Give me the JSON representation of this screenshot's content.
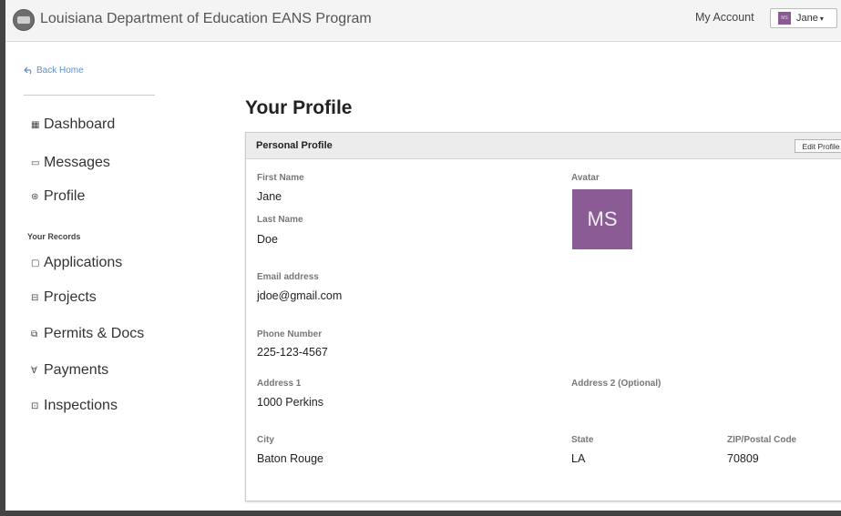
{
  "header": {
    "app_title": "Louisiana Department of Education EANS Program",
    "my_account": "My Account",
    "user_menu": {
      "initials": "MS",
      "name": "Jane",
      "caret": "▾"
    }
  },
  "sidebar": {
    "back_home": "Back Home",
    "items": [
      {
        "label": "Dashboard",
        "icon": "dashboard-icon",
        "glyph": "▦"
      },
      {
        "label": "Messages",
        "icon": "messages-icon",
        "glyph": "▭"
      },
      {
        "label": "Profile",
        "icon": "profile-icon",
        "glyph": "⊛"
      }
    ],
    "records_heading": "Your Records",
    "records": [
      {
        "label": "Applications",
        "icon": "applications-icon",
        "glyph": "▢"
      },
      {
        "label": "Projects",
        "icon": "projects-icon",
        "glyph": "⊟"
      },
      {
        "label": "Permits & Docs",
        "icon": "permits-docs-icon",
        "glyph": "⧉"
      },
      {
        "label": "Payments",
        "icon": "payments-icon",
        "glyph": "∀"
      },
      {
        "label": "Inspections",
        "icon": "inspections-icon",
        "glyph": "⊡"
      }
    ]
  },
  "main": {
    "page_title": "Your Profile",
    "panel": {
      "title": "Personal Profile",
      "edit_label": "Edit Profile",
      "fields": {
        "first_name": {
          "label": "First Name",
          "value": "Jane"
        },
        "last_name": {
          "label": "Last Name",
          "value": "Doe"
        },
        "avatar": {
          "label": "Avatar",
          "initials": "MS"
        },
        "email": {
          "label": "Email address",
          "value": "jdoe@gmail.com"
        },
        "phone": {
          "label": "Phone Number",
          "value": "225-123-4567"
        },
        "address1": {
          "label": "Address 1",
          "value": "1000 Perkins"
        },
        "address2": {
          "label": "Address 2 (Optional)",
          "value": ""
        },
        "city": {
          "label": "City",
          "value": "Baton Rouge"
        },
        "state": {
          "label": "State",
          "value": "LA"
        },
        "zip": {
          "label": "ZIP/Postal Code",
          "value": "70809"
        }
      }
    }
  },
  "colors": {
    "avatar": "#8a5b94",
    "link": "#5a8fc7",
    "header_bg": "#f4f4f4"
  }
}
